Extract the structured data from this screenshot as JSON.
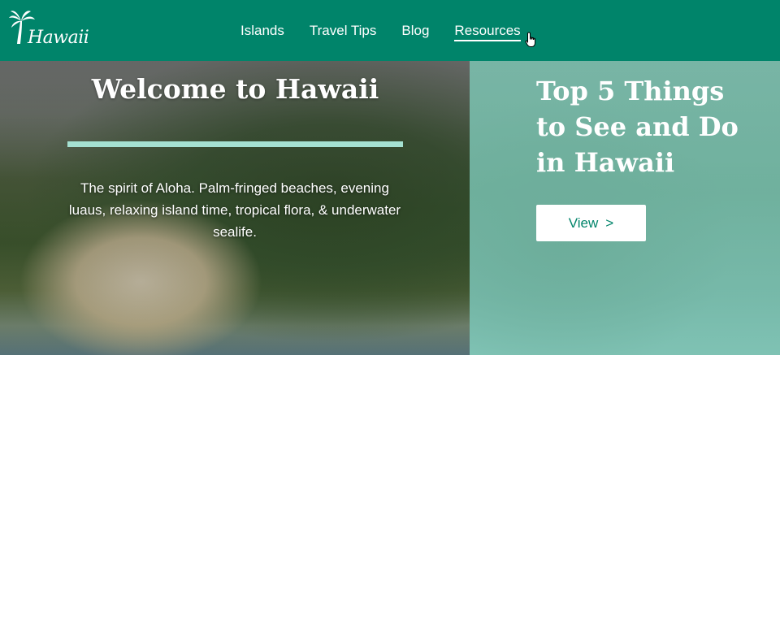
{
  "brand": {
    "logo_text": "Hawaii",
    "icon": "palm-tree-icon"
  },
  "nav": {
    "items": [
      {
        "label": "Islands"
      },
      {
        "label": "Travel Tips"
      },
      {
        "label": "Blog"
      },
      {
        "label": "Resources",
        "active": true
      }
    ]
  },
  "hero": {
    "welcome": {
      "title": "Welcome to Hawaii",
      "description": "The spirit of Aloha. Palm-fringed beaches, evening luaus, relaxing island time, tropical flora, & underwater sealife."
    },
    "promo": {
      "title": "Top 5 Things to See and Do in Hawaii",
      "button_label": "View",
      "button_chevron": ">"
    }
  },
  "colors": {
    "header_bg": "#00846a",
    "accent_rule": "#a5e1d2",
    "promo_overlay": "#7dc3b4",
    "button_text": "#00846a"
  }
}
